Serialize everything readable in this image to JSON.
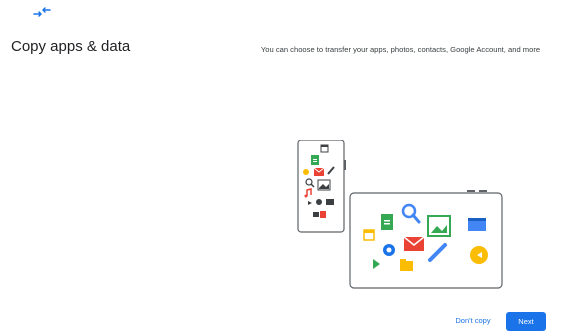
{
  "header": {
    "icon": "data-transfer-arrows-icon",
    "title": "Copy apps & data"
  },
  "main": {
    "description": "You can choose to transfer your apps, photos, contacts, Google Account, and more"
  },
  "illustration": {
    "subject": "phone-to-tablet-transfer",
    "icons": [
      "docs-icon",
      "calendar-icon",
      "gmail-icon",
      "pencil-icon",
      "search-icon",
      "photos-icon",
      "music-icon",
      "play-icon",
      "settings-icon",
      "folder-icon",
      "movie-icon",
      "contacts-icon",
      "sound-icon"
    ]
  },
  "footer": {
    "secondary_label": "Don't copy",
    "primary_label": "Next"
  },
  "colors": {
    "accent": "#1a73e8",
    "green": "#34a853",
    "red": "#ea4335",
    "yellow": "#fbbc04",
    "blue": "#4285f4"
  }
}
